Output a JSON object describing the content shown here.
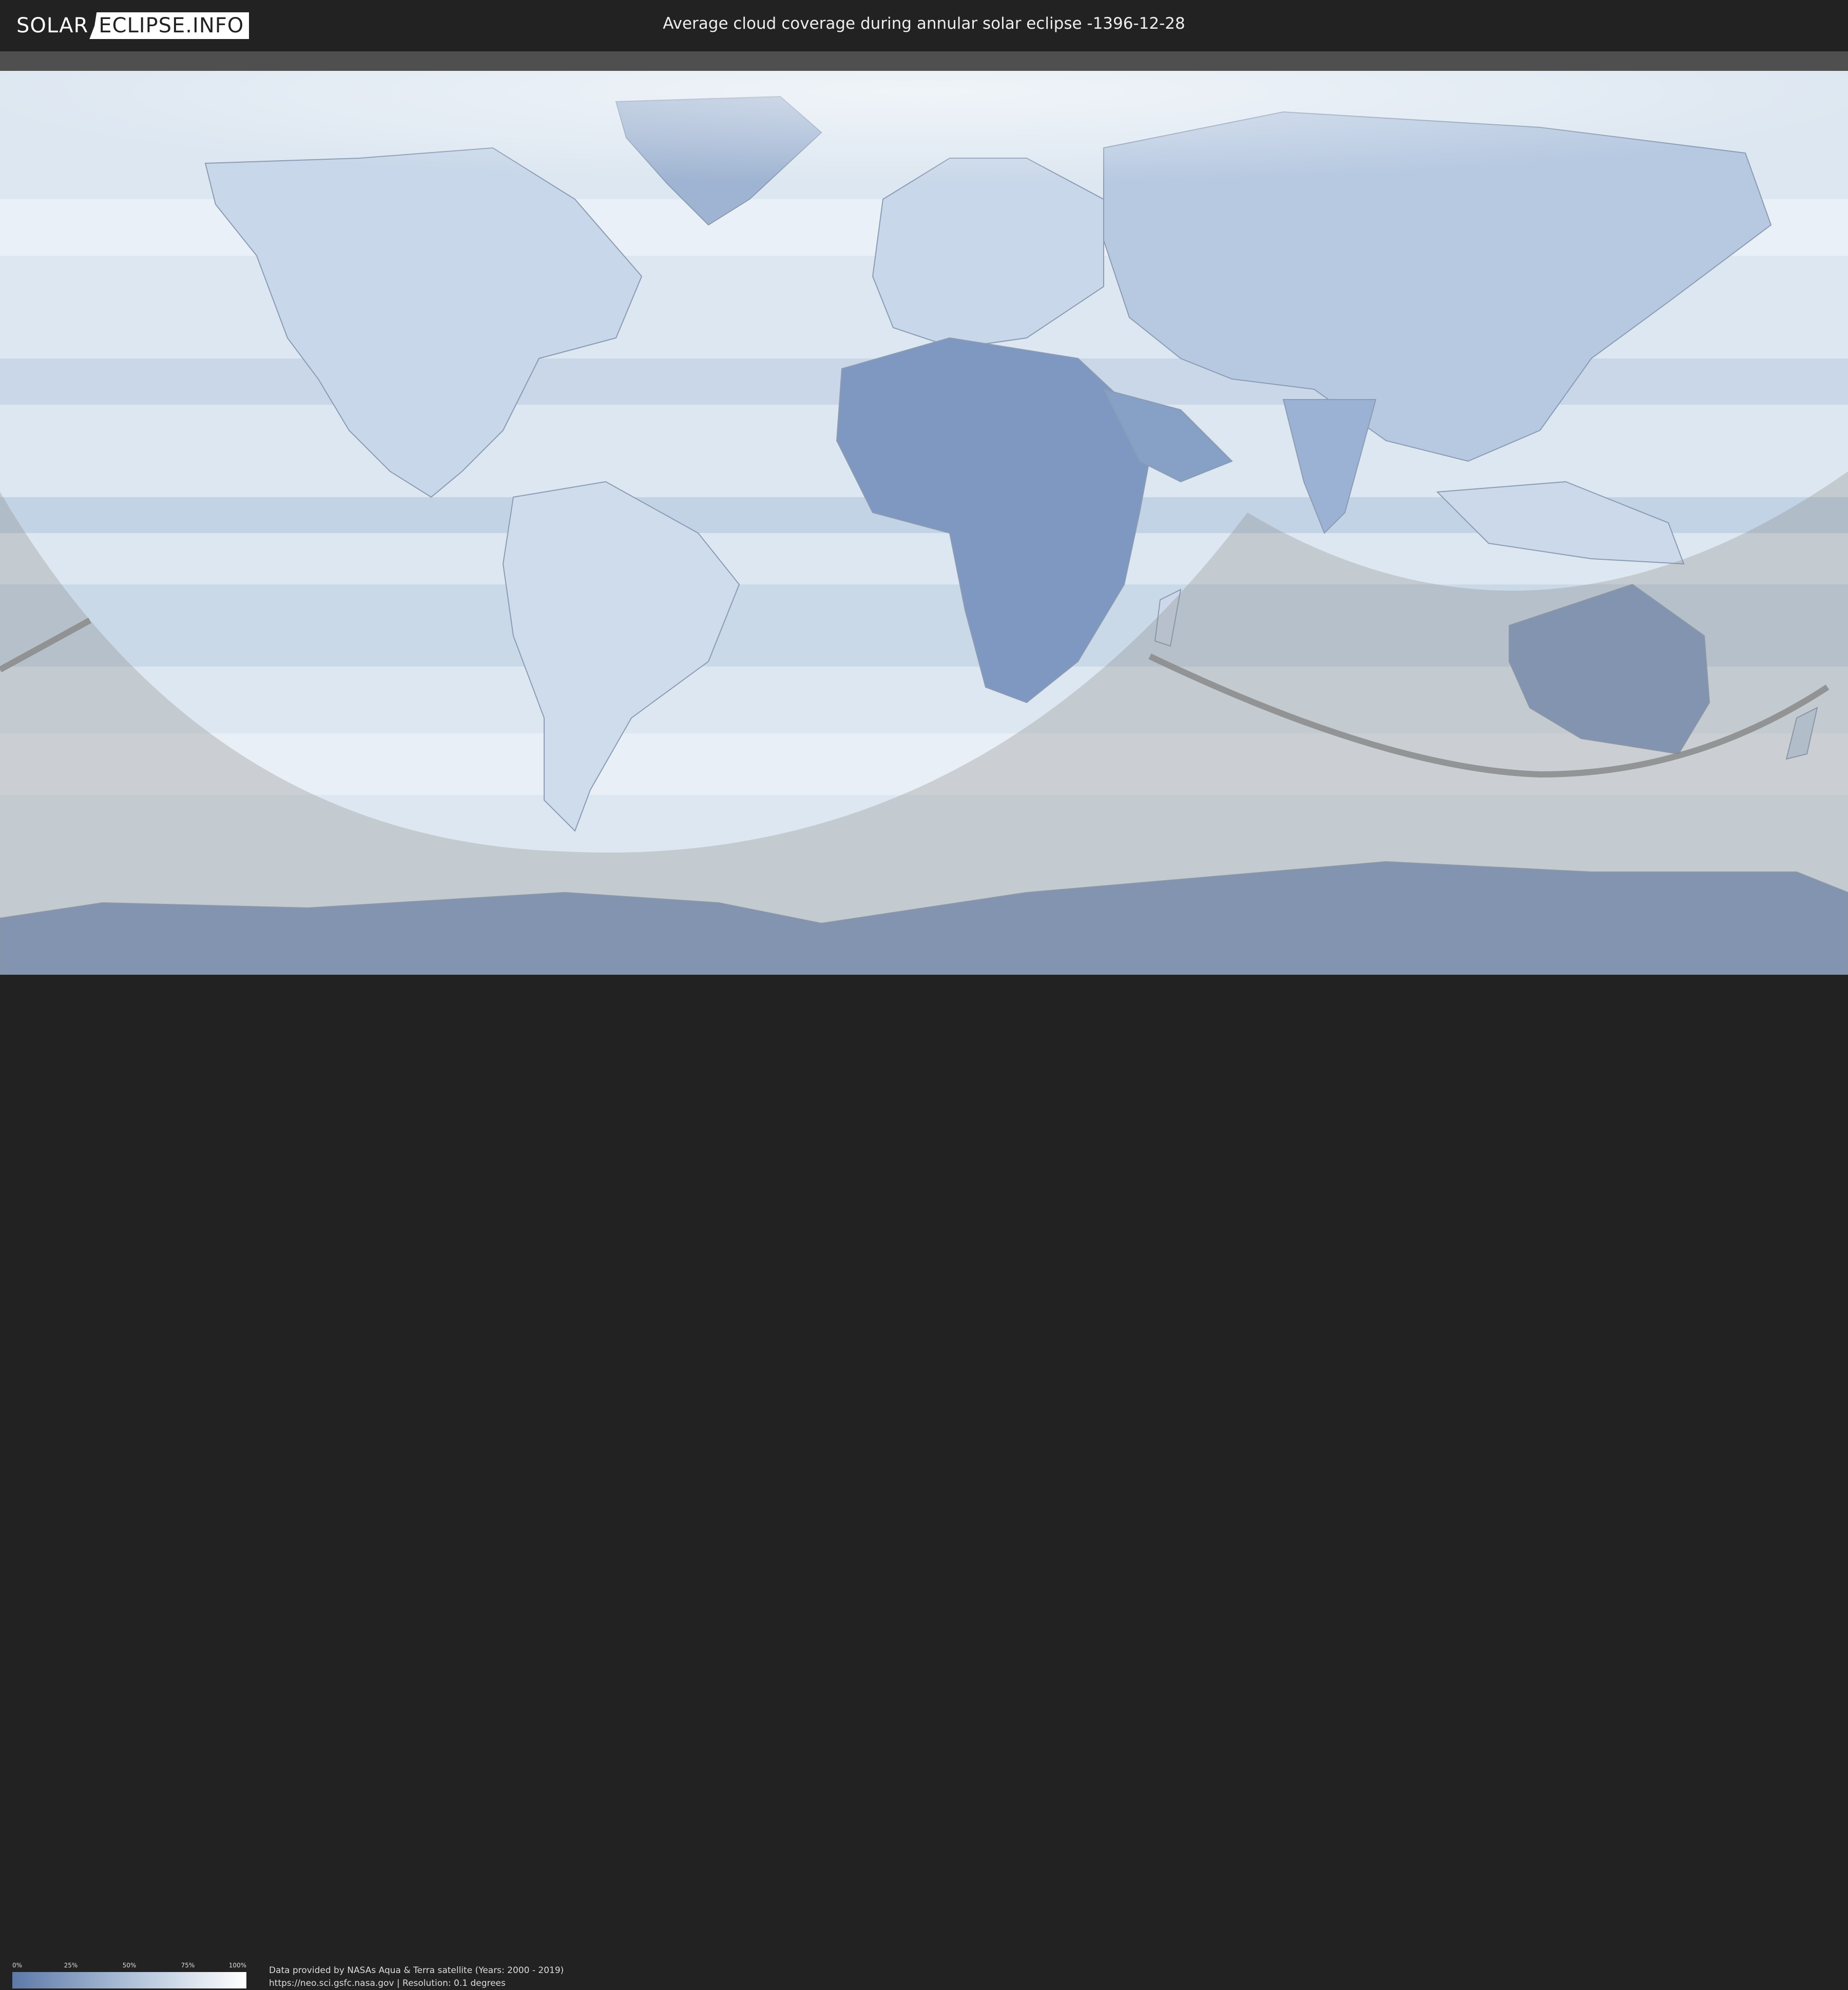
{
  "header": {
    "logo_left": "SOLAR",
    "logo_right": "ECLIPSE.INFO",
    "title": "Average cloud coverage during annular solar eclipse -1396-12-28"
  },
  "legend": {
    "ticks": [
      "0%",
      "25%",
      "50%",
      "75%",
      "100%"
    ],
    "gradient_colors": [
      "#5d79a8",
      "#aec0d8",
      "#ffffff"
    ]
  },
  "footer": {
    "credit_line1": "Data provided by NASAs Aqua & Terra satellite (Years: 2000 - 2019)",
    "credit_line2": "https://neo.sci.gsfc.nasa.gov | Resolution: 0.1 degrees"
  },
  "map": {
    "colors": {
      "ocean": "#dfe8f2",
      "land_clear": "#7f98c1",
      "land_cloudy": "#c5d5e8",
      "no_eclipse_shade": "#8c8c8c",
      "path": "#8a8a8a"
    }
  }
}
